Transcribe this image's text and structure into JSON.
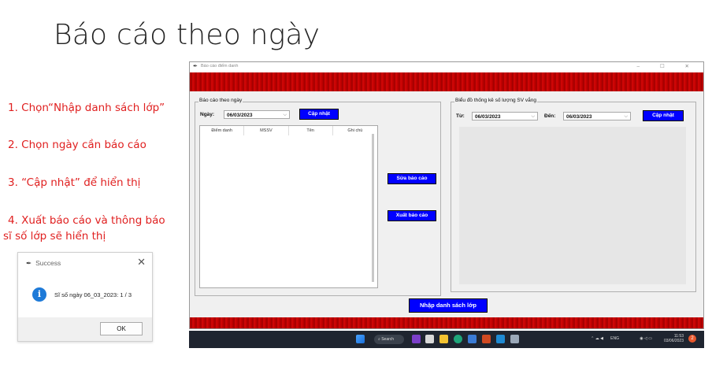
{
  "slide": {
    "title": "Báo cáo theo ngày",
    "steps": [
      "1. Chọn“Nhập danh sách lớp”",
      "2. Chọn ngày cần báo cáo",
      "3. “Cập nhật” để hiển thị",
      "4. Xuất báo cáo và thông báo",
      "sĩ số lớp sẽ hiển thị"
    ]
  },
  "dialog": {
    "title": "Success",
    "message": "Sĩ số ngày 06_03_2023: 1 / 3",
    "ok_label": "OK",
    "close_glyph": "✕"
  },
  "window": {
    "title": "Báo cáo điểm danh",
    "controls": "– ☐ ✕",
    "report_group": {
      "label": "Báo cáo theo ngày",
      "date_label": "Ngày:",
      "date_value": "06/03/2023",
      "update_label": "Cập nhật",
      "columns": [
        "Điểm danh",
        "MSSV",
        "Tên",
        "Ghi chú"
      ]
    },
    "edit_button": "Sửa báo cáo",
    "export_button": "Xuất báo cáo",
    "chart_group": {
      "label": "Biểu đồ thống kê số lượng SV vắng",
      "from_label": "Từ:",
      "from_value": "06/03/2023",
      "to_label": "Đến:",
      "to_value": "06/03/2023",
      "update_label": "Cập nhật"
    },
    "import_button": "Nhập danh sách lớp"
  },
  "taskbar": {
    "search_label": "Search",
    "lang": "ENG",
    "time": "11:53",
    "date": "03/06/2023",
    "badge": "2"
  },
  "colors": {
    "accent_button": "#0000ff",
    "banner": "#c50000",
    "step_text": "#e02020"
  }
}
